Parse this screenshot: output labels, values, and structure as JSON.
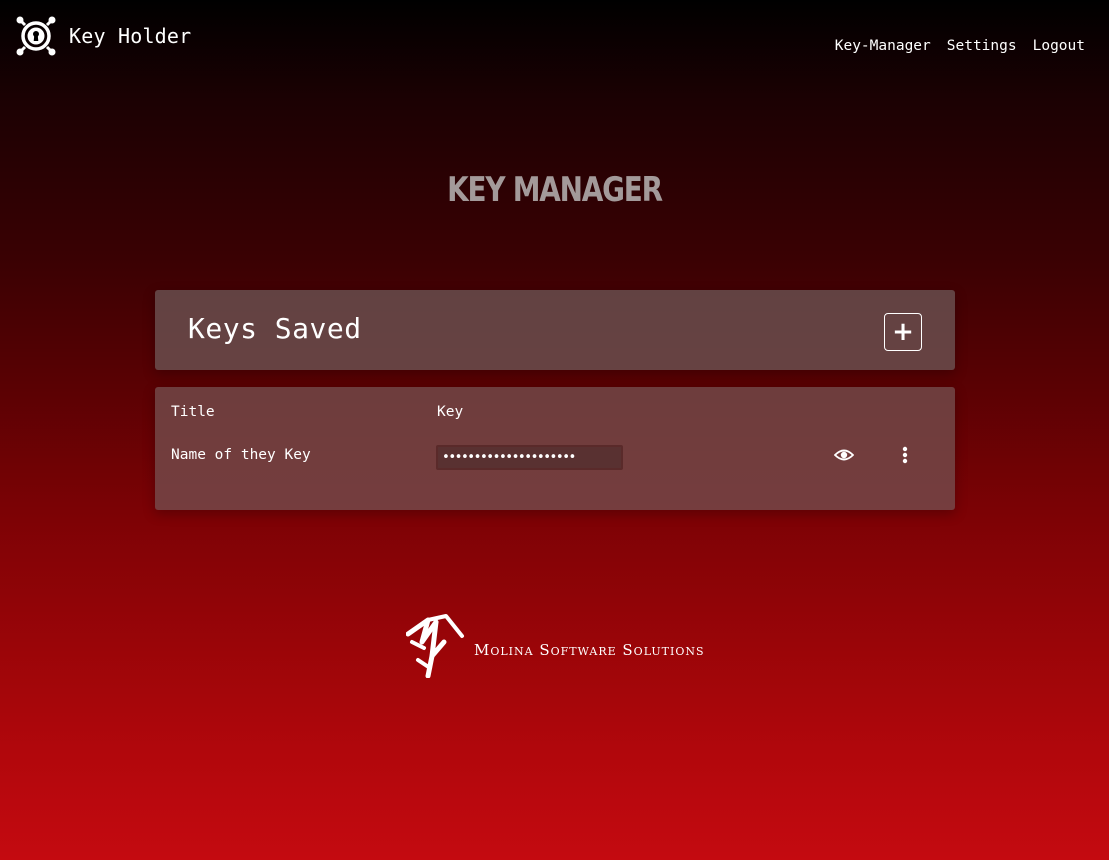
{
  "app": {
    "name": "Key Holder"
  },
  "nav": {
    "links": [
      "Key-Manager",
      "Settings",
      "Logout"
    ]
  },
  "page": {
    "title": "KEY MANAGER"
  },
  "keys_card": {
    "title": "Keys Saved",
    "add_label": "+"
  },
  "table": {
    "headers": {
      "title": "Title",
      "key": "Key"
    },
    "rows": [
      {
        "title": "Name of they Key",
        "key_masked": "•••••••••••••••••••••"
      }
    ]
  },
  "footer": {
    "company": "Molina Software Solutions"
  },
  "icons": {
    "brand": "keyhole-icon",
    "reveal": "eye-icon",
    "more": "more-vertical-icon",
    "footer": "molina-logo-icon"
  },
  "colors": {
    "gradient_top": "#000000",
    "gradient_bottom": "#c40a10",
    "page_title": "#a39a9a",
    "card_bg": "#6c5454"
  }
}
